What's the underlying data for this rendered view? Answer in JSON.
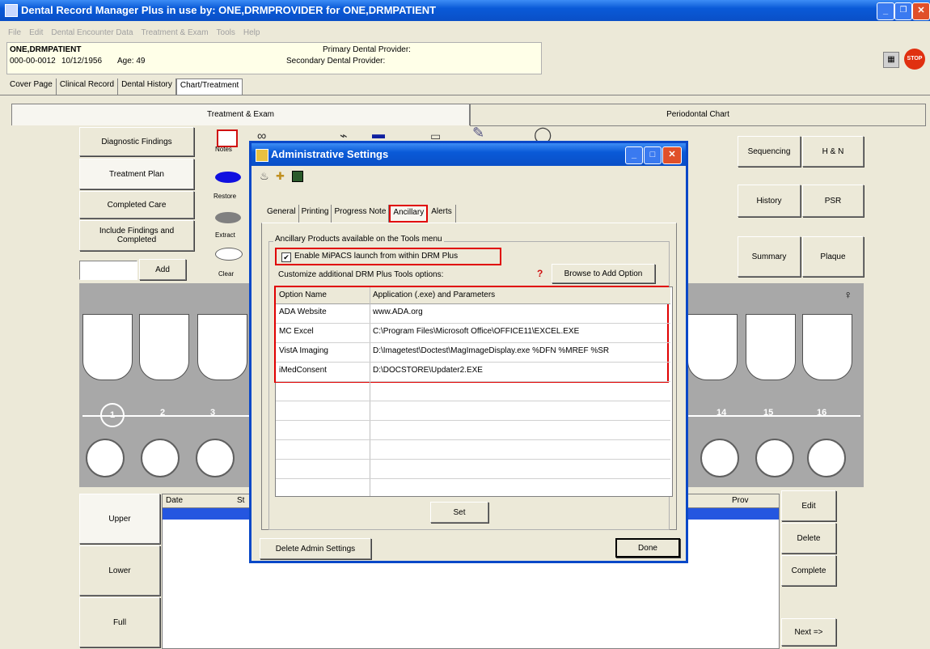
{
  "window": {
    "title": "Dental Record Manager Plus in use by: ONE,DRMPROVIDER for ONE,DRMPATIENT"
  },
  "menu": [
    "File",
    "Edit",
    "Dental Encounter Data",
    "Treatment & Exam",
    "Tools",
    "Help"
  ],
  "patient": {
    "name": "ONE,DRMPATIENT",
    "id": "000-00-0012",
    "dob": "10/12/1956",
    "age": "Age: 49",
    "primary": "Primary Dental Provider:",
    "secondary": "Secondary Dental Provider:"
  },
  "tabs": [
    "Cover Page",
    "Clinical Record",
    "Dental History",
    "Chart/Treatment"
  ],
  "subtabs": {
    "treatment": "Treatment & Exam",
    "perio": "Periodontal Chart"
  },
  "left_buttons": [
    "Diagnostic Findings",
    "Treatment Plan",
    "Completed Care",
    "Include Findings and Completed"
  ],
  "add_label": "Add",
  "tools": [
    "Notes",
    "Restore",
    "Extract",
    "Clear"
  ],
  "right_buttons": [
    "Sequencing",
    "H & N",
    "History",
    "PSR",
    "Summary",
    "Plaque"
  ],
  "teeth_numbers": [
    "1",
    "2",
    "3",
    "14",
    "15",
    "16"
  ],
  "grid_headers": [
    "Date",
    "St",
    "Prov"
  ],
  "arch_buttons": [
    "Upper",
    "Lower",
    "Full"
  ],
  "action_buttons": [
    "Edit",
    "Delete",
    "Complete",
    "Next =>"
  ],
  "dialog": {
    "title": "Administrative Settings",
    "tabs": [
      "General",
      "Printing",
      "Progress Note",
      "Ancillary",
      "Alerts"
    ],
    "group_title": "Ancillary Products available on the Tools menu",
    "checkbox_label": "Enable MiPACS launch from within DRM Plus",
    "customize_label": "Customize additional DRM Plus Tools options:",
    "help": "?",
    "browse": "Browse to Add Option",
    "table_headers": [
      "Option Name",
      "Application (.exe) and Parameters"
    ],
    "rows": [
      {
        "name": "ADA Website",
        "app": "www.ADA.org"
      },
      {
        "name": "MC Excel",
        "app": "C:\\Program Files\\Microsoft Office\\OFFICE11\\EXCEL.EXE"
      },
      {
        "name": "VistA Imaging",
        "app": "D:\\Imagetest\\Doctest\\MagImageDisplay.exe %DFN %MREF %SR"
      },
      {
        "name": "iMedConsent",
        "app": "D:\\DOCSTORE\\Updater2.EXE"
      }
    ],
    "set": "Set",
    "delete_admin": "Delete Admin Settings",
    "done": "Done"
  },
  "colors": {
    "titlebar": "#0a5ad7",
    "red": "#e00000",
    "grid_select": "#2456e0"
  }
}
